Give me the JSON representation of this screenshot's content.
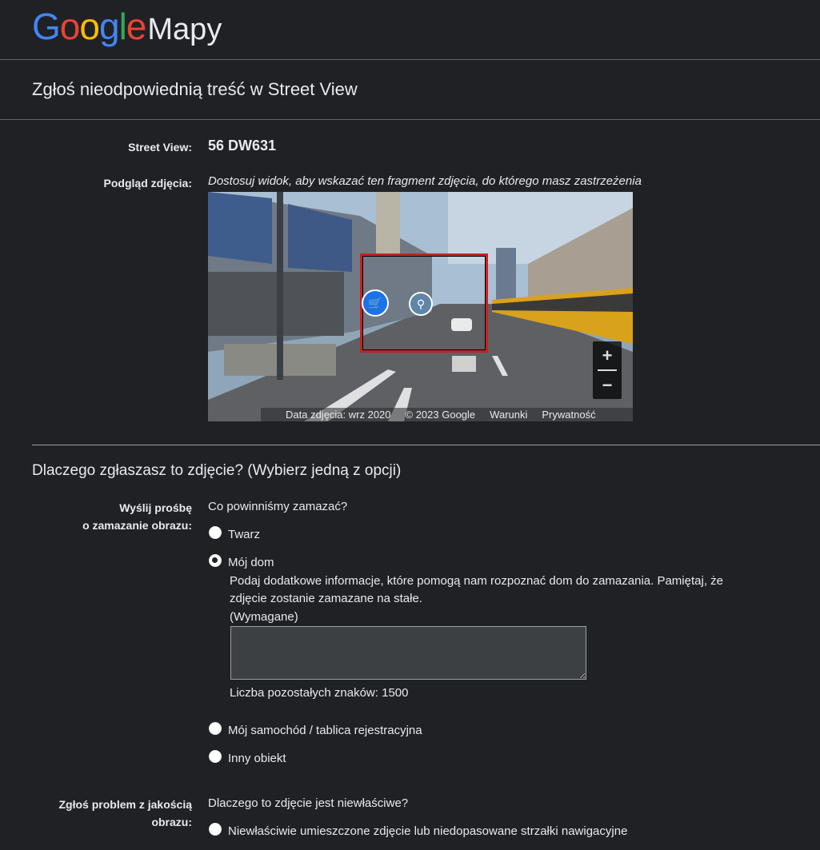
{
  "header": {
    "logo_letters": [
      "G",
      "o",
      "o",
      "g",
      "l",
      "e"
    ],
    "product": "Mapy"
  },
  "page_title": "Zgłoś nieodpowiednią treść w Street View",
  "street_view": {
    "label": "Street View:",
    "value": "56 DW631"
  },
  "preview": {
    "label": "Podgląd zdjęcia:",
    "hint": "Dostosuj widok, aby wskazać ten fragment zdjęcia, do którego masz zastrzeżenia",
    "zoom_in": "+",
    "zoom_out": "−",
    "attribution": {
      "date": "Data zdjęcia: wrz 2020",
      "copyright": "© 2023 Google",
      "terms": "Warunki",
      "privacy": "Prywatność"
    }
  },
  "reason": {
    "title": "Dlaczego zgłaszasz to zdjęcie?  (Wybierz jedną z opcji)"
  },
  "blur_request": {
    "label_line1": "Wyślij prośbę",
    "label_line2": "o zamazanie obrazu:",
    "question": "Co powinniśmy zamazać?",
    "options": [
      {
        "label": "Twarz",
        "checked": false
      },
      {
        "label": "Mój dom",
        "checked": true
      },
      {
        "label": "Mój samochód / tablica rejestracyjna",
        "checked": false
      },
      {
        "label": "Inny obiekt",
        "checked": false
      }
    ],
    "home_details_line1": "Podaj dodatkowe informacje, które pomogą nam rozpoznać dom do zamazania. Pamiętaj, że",
    "home_details_line2": "zdjęcie zostanie zamazane na stałe.",
    "required": "(Wymagane)",
    "details_value": "",
    "chars_left": "Liczba pozostałych znaków: 1500"
  },
  "quality": {
    "label_line1": "Zgłoś problem z jakością",
    "label_line2": "obrazu:",
    "question": "Dlaczego to zdjęcie jest niewłaściwe?",
    "options": [
      {
        "label": "Niewłaściwie umieszczone zdjęcie lub niedopasowane strzałki nawigacyjne",
        "checked": false
      }
    ]
  },
  "colors": {
    "background": "#202124",
    "text": "#e8eaed",
    "selection_box": "#c5221f"
  }
}
